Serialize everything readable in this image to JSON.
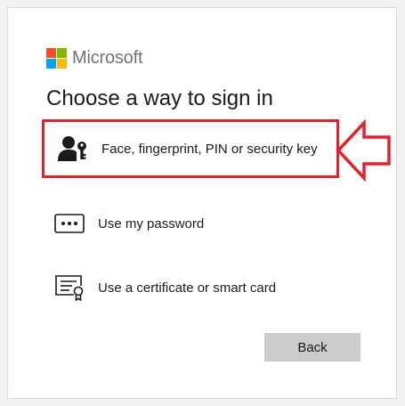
{
  "brand": {
    "name": "Microsoft",
    "colors": [
      "#f25022",
      "#7fba00",
      "#00a4ef",
      "#ffb900"
    ]
  },
  "title": "Choose a way to sign in",
  "options": [
    {
      "label": "Face, fingerprint, PIN or security key",
      "icon": "person-key-icon",
      "highlighted": true
    },
    {
      "label": "Use my password",
      "icon": "password-dots-icon",
      "highlighted": false
    },
    {
      "label": "Use a certificate or smart card",
      "icon": "certificate-icon",
      "highlighted": false
    }
  ],
  "back_label": "Back",
  "annotation": {
    "highlight_color": "#e8202a",
    "arrow_icon": "left-arrow-icon"
  }
}
